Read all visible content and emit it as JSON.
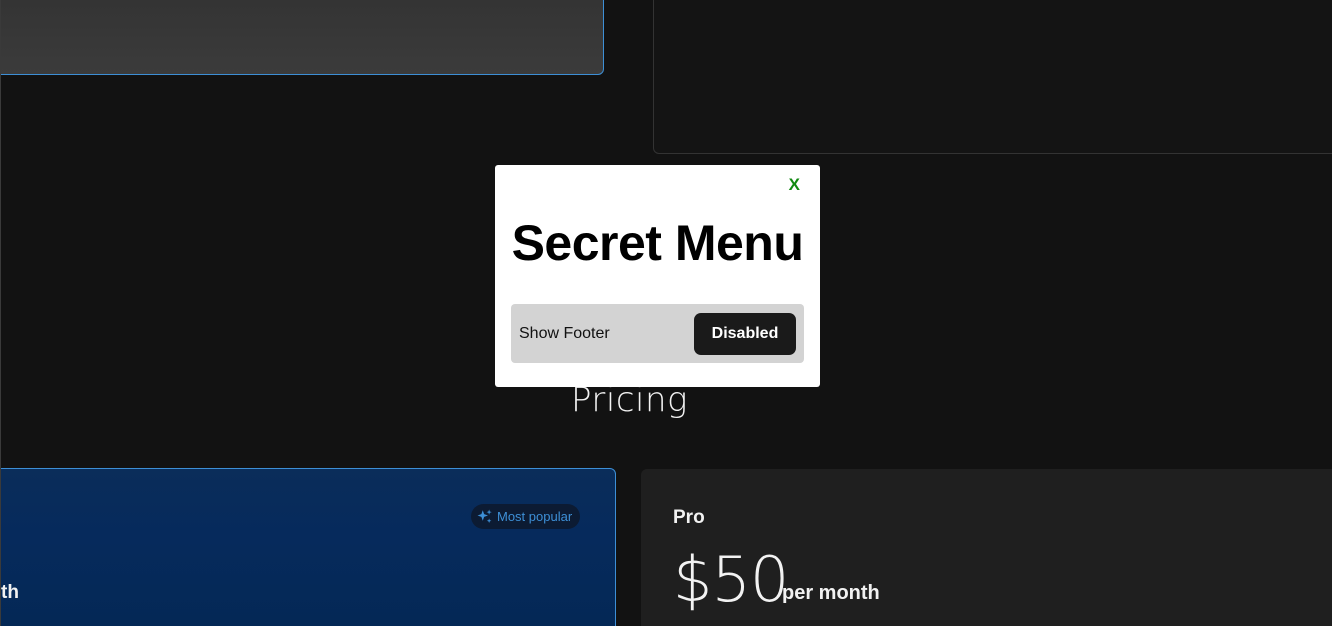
{
  "modal": {
    "close_label": "X",
    "title": "Secret Menu",
    "setting_label": "Show Footer",
    "toggle_label": "Disabled"
  },
  "pricing": {
    "heading": "Pricing",
    "featured_badge": "Most popular",
    "featured_period_fragment": "th",
    "pro_plan_name": "Pro",
    "pro_price": "$50",
    "pro_period": "per month"
  },
  "colors": {
    "accent": "#3d8fd6",
    "close": "#118a11",
    "background": "#121212"
  }
}
